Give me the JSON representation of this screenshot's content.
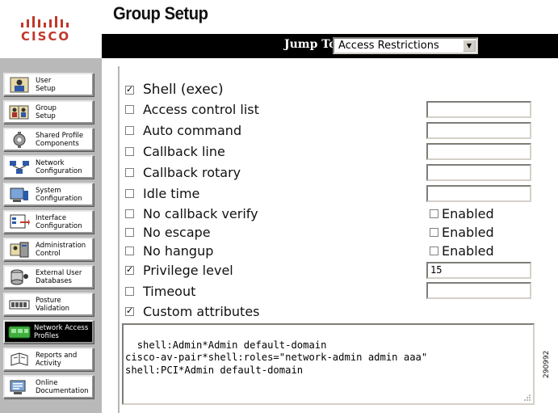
{
  "logo": {
    "text": "CISCO"
  },
  "page": {
    "title": "Group Setup"
  },
  "jump": {
    "label": "Jump To",
    "selected": "Access Restrictions"
  },
  "sidebar": {
    "items": [
      {
        "label": "User\nSetup",
        "icon": "user-icon",
        "active": false
      },
      {
        "label": "Group\nSetup",
        "icon": "group-icon",
        "active": false
      },
      {
        "label": "Shared Profile\nComponents",
        "icon": "shared-profile-icon",
        "active": false
      },
      {
        "label": "Network\nConfiguration",
        "icon": "network-icon",
        "active": false
      },
      {
        "label": "System\nConfiguration",
        "icon": "system-icon",
        "active": false
      },
      {
        "label": "Interface\nConfiguration",
        "icon": "interface-icon",
        "active": false
      },
      {
        "label": "Administration\nControl",
        "icon": "admin-icon",
        "active": false
      },
      {
        "label": "External User\nDatabases",
        "icon": "database-icon",
        "active": false
      },
      {
        "label": "Posture\nValidation",
        "icon": "posture-icon",
        "active": false
      },
      {
        "label": "Network Access\nProfiles",
        "icon": "network-access-icon",
        "active": true
      },
      {
        "label": "Reports and\nActivity",
        "icon": "reports-icon",
        "active": false
      },
      {
        "label": "Online\nDocumentation",
        "icon": "docs-icon",
        "active": false
      }
    ]
  },
  "settings": {
    "shell": {
      "label": "Shell (exec)",
      "checked": true
    },
    "acl": {
      "label": "Access control list",
      "checked": false,
      "value": ""
    },
    "auto_command": {
      "label": "Auto command",
      "checked": false,
      "value": ""
    },
    "callback_line": {
      "label": "Callback line",
      "checked": false,
      "value": ""
    },
    "callback_rotary": {
      "label": "Callback rotary",
      "checked": false,
      "value": ""
    },
    "idle_time": {
      "label": "Idle time",
      "checked": false,
      "value": ""
    },
    "no_callback_verify": {
      "label": "No callback verify",
      "checked": false,
      "enabled_label": "Enabled",
      "enabled": false
    },
    "no_escape": {
      "label": "No escape",
      "checked": false,
      "enabled_label": "Enabled",
      "enabled": false
    },
    "no_hangup": {
      "label": "No hangup",
      "checked": false,
      "enabled_label": "Enabled",
      "enabled": false
    },
    "privilege_level": {
      "label": "Privilege level",
      "checked": true,
      "value": "15"
    },
    "timeout": {
      "label": "Timeout",
      "checked": false,
      "value": ""
    },
    "custom_attributes": {
      "label": "Custom attributes",
      "checked": true,
      "value": "shell:Admin*Admin default-domain\ncisco-av-pair*shell:roles=\"network-admin admin aaa\"\nshell:PCI*Admin default-domain"
    }
  },
  "figure": {
    "id": "290992"
  }
}
